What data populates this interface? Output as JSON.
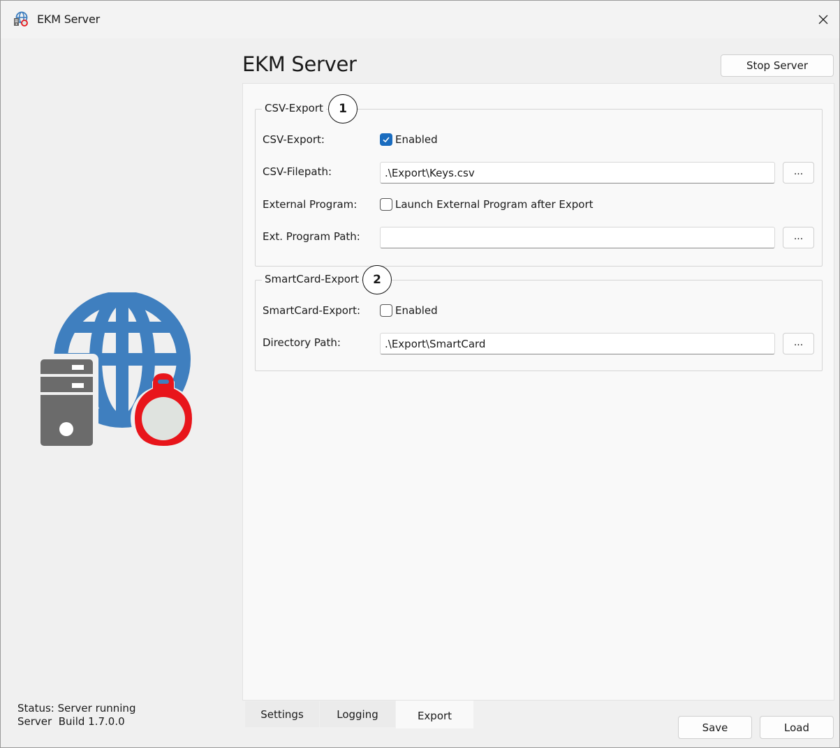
{
  "window": {
    "title": "EKM Server",
    "app_icon": "globe-server-keyfob-icon",
    "close_icon": "close-icon"
  },
  "header": {
    "title": "EKM Server",
    "stop_button": "Stop Server"
  },
  "csv_group": {
    "legend": "CSV-Export",
    "badge": "1",
    "rows": {
      "export_label": "CSV-Export:",
      "export_checkbox_label": "Enabled",
      "export_checked": true,
      "filepath_label": "CSV-Filepath:",
      "filepath_value": ".\\Export\\Keys.csv",
      "filepath_browse": "...",
      "external_label": "External Program:",
      "external_checkbox_label": "Launch External Program after Export",
      "external_checked": false,
      "extpath_label": "Ext. Program Path:",
      "extpath_value": "",
      "extpath_browse": "..."
    }
  },
  "smartcard_group": {
    "legend": "SmartCard-Export",
    "badge": "2",
    "rows": {
      "export_label": "SmartCard-Export:",
      "export_checkbox_label": "Enabled",
      "export_checked": false,
      "dir_label": "Directory Path:",
      "dir_value": ".\\Export\\SmartCard",
      "dir_browse": "..."
    }
  },
  "tabs": [
    {
      "label": "Settings",
      "active": false
    },
    {
      "label": "Logging",
      "active": false
    },
    {
      "label": "Export",
      "active": true
    }
  ],
  "status": {
    "line1": "Status: Server running",
    "line2": "Server  Build 1.7.0.0"
  },
  "footer": {
    "save": "Save",
    "load": "Load"
  },
  "colors": {
    "accent": "#1a6cbf",
    "globe": "#3f7fbf",
    "server": "#6b6b6b",
    "keyfob": "#e8151b"
  }
}
